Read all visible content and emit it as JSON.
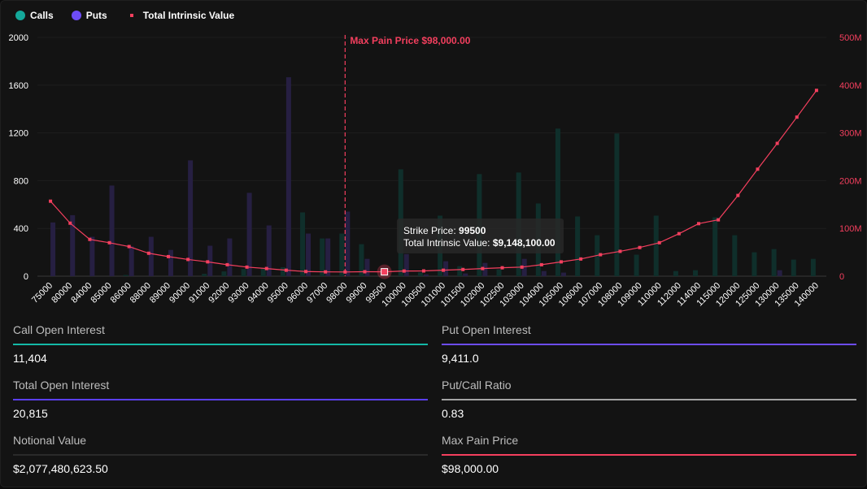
{
  "legend": {
    "calls": "Calls",
    "puts": "Puts",
    "tiv": "Total Intrinsic Value"
  },
  "colors": {
    "calls": "#14b8a6",
    "puts": "#6d4cf6",
    "tiv": "#f43f5e",
    "calls_bar": "#0f2f2b",
    "puts_bar": "#261f42"
  },
  "tooltip": {
    "strike_label": "Strike Price:",
    "strike_value": "99500",
    "tiv_label": "Total Intrinsic Value:",
    "tiv_value": "$9,148,100.00"
  },
  "chart_data": {
    "type": "bar",
    "max_pain_label": "Max Pain Price $98,000.00",
    "max_pain_strike": "98000",
    "categories": [
      "75000",
      "80000",
      "84000",
      "85000",
      "86000",
      "88000",
      "89000",
      "90000",
      "91000",
      "92000",
      "93000",
      "94000",
      "95000",
      "96000",
      "97000",
      "98000",
      "99000",
      "99500",
      "100000",
      "100500",
      "101000",
      "101500",
      "102000",
      "102500",
      "103000",
      "104000",
      "105000",
      "106000",
      "107000",
      "108000",
      "109000",
      "110000",
      "112000",
      "114000",
      "115000",
      "120000",
      "125000",
      "130000",
      "135000",
      "140000"
    ],
    "series": [
      {
        "name": "Calls",
        "axis": "left",
        "values": [
          0,
          0,
          0,
          0,
          10,
          0,
          0,
          0,
          20,
          40,
          60,
          70,
          75,
          534,
          316,
          357,
          268,
          0,
          895,
          32,
          507,
          84,
          855,
          57,
          868,
          609,
          1236,
          500,
          343,
          1195,
          180,
          507,
          43,
          50,
          493,
          343,
          200,
          227,
          139,
          145
        ]
      },
      {
        "name": "Puts",
        "axis": "left",
        "values": [
          450,
          511,
          330,
          759,
          250,
          330,
          220,
          970,
          255,
          316,
          698,
          425,
          1666,
          357,
          316,
          541,
          145,
          0,
          185,
          15,
          125,
          23,
          111,
          0,
          145,
          43,
          30,
          0,
          0,
          0,
          0,
          0,
          0,
          0,
          0,
          0,
          0,
          50,
          0,
          0
        ]
      },
      {
        "name": "Total Intrinsic Value",
        "axis": "right",
        "type": "line",
        "values": [
          157,
          111,
          77,
          70,
          62,
          48,
          41,
          35,
          30,
          24,
          19,
          16,
          12.5,
          9.7,
          9,
          8.8,
          9.3,
          9.15,
          10.8,
          11,
          12.5,
          14,
          16,
          17.6,
          19,
          24,
          30,
          36,
          45,
          52,
          60,
          70,
          89,
          110,
          118,
          169,
          224,
          278,
          333,
          389
        ]
      }
    ],
    "y_left": {
      "ticks": [
        "0",
        "400",
        "800",
        "1200",
        "1600",
        "2000"
      ],
      "range": [
        0,
        2000
      ]
    },
    "y_right": {
      "ticks": [
        "0",
        "100M",
        "200M",
        "300M",
        "400M",
        "500M"
      ],
      "range": [
        0,
        500
      ],
      "unit": "M"
    },
    "grid": true,
    "legend_position": "top-left"
  },
  "stats": [
    {
      "label": "Call Open Interest",
      "value": "11,404",
      "color": "#14b8a6"
    },
    {
      "label": "Put Open Interest",
      "value": "9,411.0",
      "color": "#6d4cf6"
    },
    {
      "label": "Total Open Interest",
      "value": "20,815",
      "color": "#5b3ff0"
    },
    {
      "label": "Put/Call Ratio",
      "value": "0.83",
      "color": "#a3a3a3"
    },
    {
      "label": "Notional Value",
      "value": "$2,077,480,623.50",
      "color": "#2a2a2a"
    },
    {
      "label": "Max Pain Price",
      "value": "$98,000.00",
      "color": "#f43f5e"
    }
  ]
}
